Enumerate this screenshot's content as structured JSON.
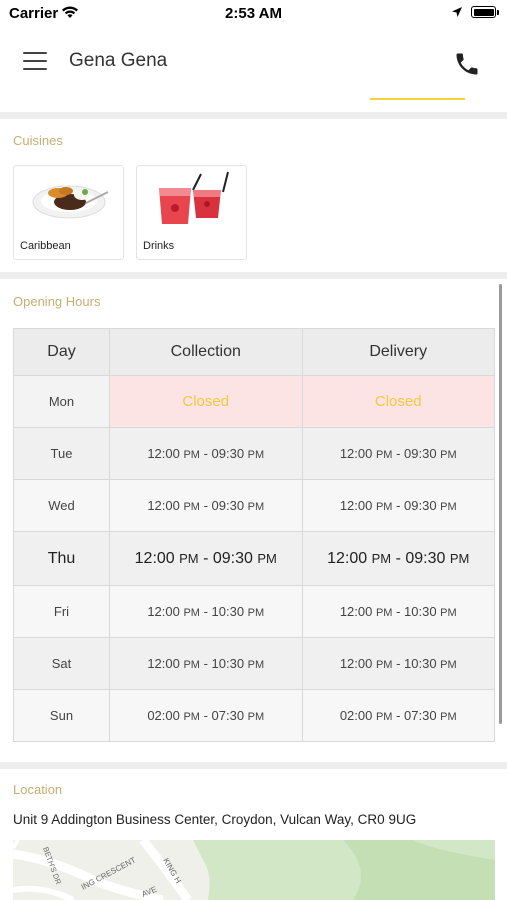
{
  "status_bar": {
    "carrier": "Carrier",
    "time": "2:53 AM"
  },
  "header": {
    "title": "Gena Gena",
    "underline_color": "#f5d23e"
  },
  "cuisines": {
    "label": "Cuisines",
    "items": [
      {
        "label": "Caribbean",
        "icon": "caribbean-dish-image"
      },
      {
        "label": "Drinks",
        "icon": "drinks-image"
      }
    ]
  },
  "opening_hours": {
    "label": "Opening Hours",
    "columns": [
      "Day",
      "Collection",
      "Delivery"
    ],
    "rows": [
      {
        "day": "Mon",
        "collection": "Closed",
        "delivery": "Closed",
        "closed": true
      },
      {
        "day": "Tue",
        "collection": "12:00 PM - 09:30 PM",
        "delivery": "12:00 PM - 09:30 PM"
      },
      {
        "day": "Wed",
        "collection": "12:00 PM - 09:30 PM",
        "delivery": "12:00 PM - 09:30 PM"
      },
      {
        "day": "Thu",
        "collection": "12:00 PM - 09:30 PM",
        "delivery": "12:00 PM - 09:30 PM",
        "today": true
      },
      {
        "day": "Fri",
        "collection": "12:00 PM - 10:30 PM",
        "delivery": "12:00 PM - 10:30 PM"
      },
      {
        "day": "Sat",
        "collection": "12:00 PM - 10:30 PM",
        "delivery": "12:00 PM - 10:30 PM"
      },
      {
        "day": "Sun",
        "collection": "02:00 PM - 07:30 PM",
        "delivery": "02:00 PM - 07:30 PM"
      }
    ]
  },
  "location": {
    "label": "Location",
    "address": "Unit 9 Addington Business Center, Croydon, Vulcan Way, CR0 9UG",
    "map_labels": [
      "BETH'S DR",
      "ING CRESCENT",
      "AVE",
      "KING H"
    ]
  },
  "colors": {
    "accent": "#f5d23e",
    "section_label": "#c7ae72",
    "closed_bg": "#fde4e4"
  }
}
